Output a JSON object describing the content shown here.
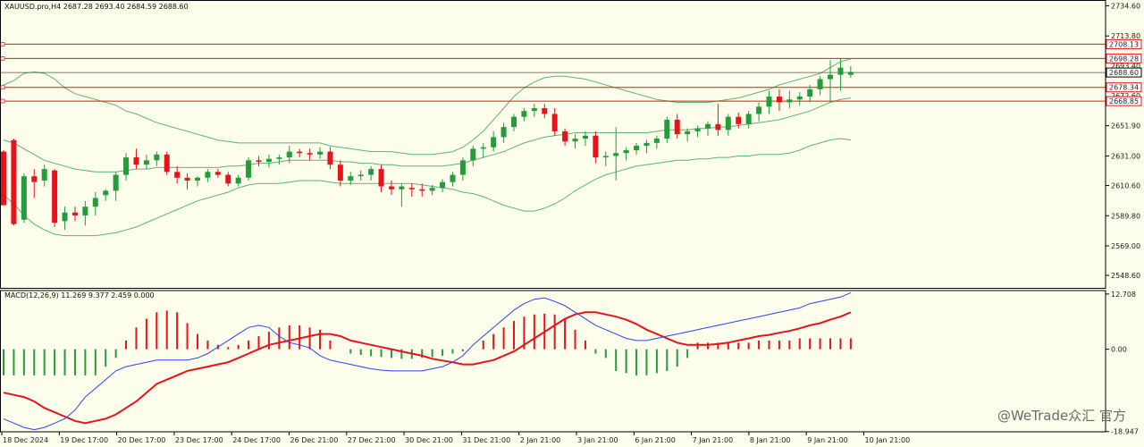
{
  "header": {
    "symbol_info": "XAUUSD.pro,H4  2687.28 2693.40 2684.59 2688.60",
    "macd_info": "MACD(12,26,9) 11.269 9.377 2.459 0.000"
  },
  "watermark": "@WeTrade众汇 官方",
  "colors": {
    "background": "#fcfdea",
    "bull": "#239c3c",
    "bear": "#e8131a",
    "bands": "#5cb572",
    "level_line": "#e8131a",
    "macd_signal": "#e8131a",
    "macd_main": "#2d44f0"
  },
  "price_axis": {
    "min": 2540,
    "max": 2738,
    "ticks": [
      "2734.60",
      "2713.80",
      "2651.90",
      "2631.00",
      "2610.60",
      "2589.80",
      "2569.00",
      "2548.60"
    ],
    "hidden_ticks": [
      "2693.40",
      "2672.60"
    ]
  },
  "level_labels": [
    {
      "value": 2708.13,
      "label": "2708.13"
    },
    {
      "value": 2698.28,
      "label": "2698.28"
    },
    {
      "value": 2678.34,
      "label": "2678.34"
    },
    {
      "value": 2668.85,
      "label": "2668.85"
    }
  ],
  "current_price": {
    "value": 2688.6,
    "label": "2688.60"
  },
  "macd_axis": {
    "min": -19,
    "max": 13.5,
    "ticks": [
      "12.708",
      "0.00",
      "-18.947"
    ]
  },
  "time_axis": [
    "18 Dec 2024",
    "19 Dec 17:00",
    "20 Dec 17:00",
    "23 Dec 17:00",
    "24 Dec 17:00",
    "26 Dec 21:00",
    "27 Dec 21:00",
    "30 Dec 21:00",
    "31 Dec 21:00",
    "2 Jan 21:00",
    "3 Jan 21:00",
    "6 Jan 21:00",
    "7 Jan 21:00",
    "8 Jan 21:00",
    "9 Jan 21:00",
    "10 Jan 21:00"
  ],
  "chart_data": {
    "type": "candlestick",
    "symbol": "XAUUSD.pro",
    "timeframe": "H4",
    "candles": [
      [
        2634,
        2635,
        2598,
        2597
      ],
      [
        2642,
        2643,
        2583,
        2584
      ],
      [
        2587,
        2619,
        2585,
        2617
      ],
      [
        2617,
        2622,
        2602,
        2613
      ],
      [
        2614,
        2625,
        2610,
        2622
      ],
      [
        2621,
        2622,
        2582,
        2585
      ],
      [
        2586,
        2596,
        2580,
        2592
      ],
      [
        2592,
        2596,
        2586,
        2590
      ],
      [
        2590,
        2600,
        2583,
        2596
      ],
      [
        2596,
        2606,
        2590,
        2602
      ],
      [
        2604,
        2608,
        2600,
        2607
      ],
      [
        2607,
        2620,
        2600,
        2618
      ],
      [
        2618,
        2633,
        2614,
        2630
      ],
      [
        2630,
        2636,
        2622,
        2625
      ],
      [
        2625,
        2632,
        2622,
        2628
      ],
      [
        2628,
        2634,
        2624,
        2632
      ],
      [
        2632,
        2634,
        2618,
        2620
      ],
      [
        2620,
        2624,
        2612,
        2616
      ],
      [
        2616,
        2619,
        2608,
        2614
      ],
      [
        2614,
        2617,
        2610,
        2616
      ],
      [
        2616,
        2622,
        2613,
        2620
      ],
      [
        2620,
        2622,
        2616,
        2618
      ],
      [
        2618,
        2620,
        2610,
        2612
      ],
      [
        2612,
        2618,
        2610,
        2616
      ],
      [
        2616,
        2630,
        2614,
        2628
      ],
      [
        2628,
        2631,
        2624,
        2627
      ],
      [
        2627,
        2632,
        2623,
        2629
      ],
      [
        2629,
        2632,
        2625,
        2630
      ],
      [
        2630,
        2638,
        2626,
        2634
      ],
      [
        2634,
        2636,
        2630,
        2633
      ],
      [
        2633,
        2636,
        2628,
        2632
      ],
      [
        2632,
        2637,
        2629,
        2634
      ],
      [
        2634,
        2637,
        2622,
        2625
      ],
      [
        2625,
        2628,
        2610,
        2614
      ],
      [
        2614,
        2620,
        2611,
        2617
      ],
      [
        2617,
        2621,
        2614,
        2618
      ],
      [
        2618,
        2624,
        2614,
        2622
      ],
      [
        2622,
        2625,
        2606,
        2610
      ],
      [
        2610,
        2614,
        2604,
        2608
      ],
      [
        2608,
        2612,
        2596,
        2610
      ],
      [
        2609,
        2612,
        2603,
        2608
      ],
      [
        2608,
        2612,
        2603,
        2607
      ],
      [
        2607,
        2611,
        2604,
        2609
      ],
      [
        2609,
        2615,
        2606,
        2613
      ],
      [
        2613,
        2620,
        2610,
        2618
      ],
      [
        2618,
        2630,
        2614,
        2628
      ],
      [
        2628,
        2638,
        2624,
        2636
      ],
      [
        2636,
        2640,
        2630,
        2637
      ],
      [
        2637,
        2648,
        2634,
        2644
      ],
      [
        2644,
        2654,
        2640,
        2651
      ],
      [
        2651,
        2660,
        2648,
        2658
      ],
      [
        2658,
        2664,
        2655,
        2662
      ],
      [
        2662,
        2667,
        2658,
        2664
      ],
      [
        2664,
        2667,
        2657,
        2660
      ],
      [
        2660,
        2664,
        2645,
        2648
      ],
      [
        2648,
        2650,
        2638,
        2641
      ],
      [
        2641,
        2646,
        2636,
        2643
      ],
      [
        2643,
        2648,
        2638,
        2645
      ],
      [
        2645,
        2648,
        2626,
        2630
      ],
      [
        2630,
        2634,
        2624,
        2631
      ],
      [
        2631,
        2651,
        2614,
        2633
      ],
      [
        2633,
        2637,
        2628,
        2635
      ],
      [
        2635,
        2640,
        2632,
        2638
      ],
      [
        2638,
        2642,
        2633,
        2640
      ],
      [
        2640,
        2645,
        2636,
        2643
      ],
      [
        2643,
        2658,
        2640,
        2656
      ],
      [
        2656,
        2660,
        2643,
        2646
      ],
      [
        2646,
        2650,
        2641,
        2648
      ],
      [
        2648,
        2652,
        2644,
        2650
      ],
      [
        2650,
        2655,
        2645,
        2653
      ],
      [
        2653,
        2667,
        2645,
        2649
      ],
      [
        2649,
        2660,
        2645,
        2658
      ],
      [
        2658,
        2661,
        2650,
        2653
      ],
      [
        2653,
        2662,
        2650,
        2660
      ],
      [
        2660,
        2668,
        2655,
        2665
      ],
      [
        2665,
        2676,
        2660,
        2672
      ],
      [
        2672,
        2677,
        2662,
        2668
      ],
      [
        2668,
        2676,
        2664,
        2670
      ],
      [
        2670,
        2675,
        2666,
        2672
      ],
      [
        2672,
        2680,
        2668,
        2677
      ],
      [
        2677,
        2686,
        2673,
        2684
      ],
      [
        2684,
        2697,
        2668,
        2687
      ],
      [
        2687,
        2698,
        2676,
        2692
      ],
      [
        2687,
        2693,
        2685,
        2689
      ]
    ],
    "bollinger": {
      "upper": [
        2680,
        2683,
        2688,
        2689,
        2688,
        2684,
        2678,
        2674,
        2672,
        2670,
        2668,
        2666,
        2662,
        2660,
        2657,
        2654,
        2652,
        2650,
        2648,
        2646,
        2644,
        2642,
        2641,
        2640,
        2640,
        2640,
        2640,
        2640,
        2640,
        2640,
        2640,
        2640,
        2638,
        2637,
        2636,
        2635,
        2634,
        2634,
        2634,
        2633,
        2632,
        2632,
        2632,
        2633,
        2634,
        2637,
        2642,
        2648,
        2656,
        2664,
        2672,
        2678,
        2682,
        2685,
        2686,
        2686,
        2685,
        2684,
        2682,
        2680,
        2678,
        2676,
        2674,
        2672,
        2670,
        2669,
        2668,
        2668,
        2668,
        2668,
        2669,
        2670,
        2671,
        2673,
        2675,
        2677,
        2680,
        2682,
        2684,
        2686,
        2688,
        2692,
        2696,
        2698
      ],
      "middle": [
        2642,
        2640,
        2636,
        2632,
        2628,
        2626,
        2624,
        2622,
        2621,
        2620,
        2620,
        2620,
        2621,
        2622,
        2622,
        2623,
        2623,
        2623,
        2623,
        2623,
        2623,
        2623,
        2624,
        2624,
        2625,
        2626,
        2626,
        2627,
        2628,
        2628,
        2628,
        2628,
        2628,
        2627,
        2627,
        2626,
        2626,
        2625,
        2625,
        2624,
        2624,
        2624,
        2624,
        2624,
        2625,
        2626,
        2628,
        2630,
        2632,
        2634,
        2637,
        2640,
        2642,
        2644,
        2645,
        2646,
        2647,
        2647,
        2647,
        2647,
        2647,
        2647,
        2647,
        2647,
        2648,
        2649,
        2649,
        2649,
        2650,
        2650,
        2651,
        2651,
        2652,
        2653,
        2654,
        2655,
        2656,
        2658,
        2660,
        2662,
        2665,
        2668,
        2670,
        2671
      ],
      "lower": [
        2604,
        2598,
        2590,
        2584,
        2580,
        2577,
        2576,
        2576,
        2576,
        2576,
        2577,
        2578,
        2580,
        2582,
        2585,
        2588,
        2591,
        2594,
        2597,
        2600,
        2602,
        2604,
        2606,
        2609,
        2611,
        2612,
        2612,
        2612,
        2613,
        2614,
        2614,
        2614,
        2613,
        2612,
        2612,
        2612,
        2612,
        2612,
        2612,
        2612,
        2612,
        2611,
        2610,
        2609,
        2608,
        2606,
        2605,
        2603,
        2600,
        2597,
        2595,
        2593,
        2593,
        2595,
        2598,
        2602,
        2607,
        2611,
        2615,
        2618,
        2620,
        2622,
        2624,
        2625,
        2626,
        2627,
        2628,
        2628,
        2629,
        2629,
        2630,
        2630,
        2631,
        2631,
        2632,
        2632,
        2632,
        2633,
        2635,
        2638,
        2640,
        2642,
        2643,
        2642
      ]
    },
    "levels": [
      2708.13,
      2698.28,
      2678.34,
      2668.85
    ],
    "macd": {
      "histogram": [
        -6,
        -6,
        -6,
        -6,
        -6,
        -6,
        -6,
        -6,
        -6,
        -6,
        -4,
        -2,
        2,
        5,
        7,
        8.5,
        8.9,
        8.5,
        6,
        3.5,
        2,
        1,
        0.5,
        1,
        2,
        3,
        4,
        5,
        5.5,
        5.5,
        5,
        4.5,
        2,
        0,
        -1,
        -1.3,
        -1.6,
        -1.8,
        -2,
        -2.2,
        -2.2,
        -2,
        -1.8,
        -1.5,
        -1,
        -0.5,
        0,
        2,
        3.5,
        5,
        6.5,
        7.5,
        8,
        8.2,
        8,
        7,
        4.5,
        2,
        -1,
        -2,
        -5,
        -5.5,
        -6,
        -6,
        -5.5,
        -5,
        -4,
        -2,
        1.5,
        1.5,
        1.5,
        1.5,
        1.5,
        1.5,
        2,
        2,
        2,
        2,
        2.5,
        2.5,
        2.5,
        2.5,
        2.5,
        2.5
      ],
      "signal": [
        -10,
        -10.5,
        -11,
        -12,
        -13.5,
        -14.5,
        -15.5,
        -16.5,
        -17,
        -16.5,
        -16,
        -15,
        -13.5,
        -12,
        -10,
        -8,
        -7,
        -6,
        -5,
        -4.5,
        -4,
        -3.5,
        -3,
        -2,
        -1,
        0,
        1,
        1.5,
        2,
        2.5,
        3,
        3.5,
        3.5,
        3,
        2,
        1.5,
        1,
        0.5,
        0,
        -0.5,
        -1,
        -1.5,
        -2.2,
        -2.6,
        -3,
        -3.5,
        -3.5,
        -3,
        -2.5,
        -1.5,
        -0.5,
        1,
        2.5,
        4,
        5.5,
        7,
        8,
        8.5,
        8.5,
        8,
        7.5,
        6.8,
        5.8,
        4.5,
        3.5,
        2.5,
        1.5,
        1,
        1,
        1,
        1.2,
        1.5,
        2,
        2.5,
        3,
        3.3,
        3.8,
        4.2,
        4.8,
        5.5,
        6,
        6.8,
        7.5,
        8.5
      ],
      "main": [
        -16,
        -17,
        -18,
        -18.5,
        -18,
        -17,
        -16,
        -14,
        -11,
        -9,
        -7,
        -5,
        -4,
        -3.5,
        -3,
        -2.5,
        -2.5,
        -2.5,
        -2.5,
        -2,
        -1,
        0.5,
        2,
        3.5,
        5,
        5.5,
        5,
        3,
        1.5,
        1,
        0.3,
        -1.5,
        -2.5,
        -3,
        -3.5,
        -4,
        -4.5,
        -4.8,
        -5,
        -5,
        -5,
        -5,
        -4.5,
        -4,
        -3,
        -1.5,
        1,
        3,
        5,
        7,
        9,
        10.5,
        11.5,
        11.8,
        11,
        10,
        8.5,
        7,
        5.5,
        4.5,
        3.5,
        2.5,
        2,
        2,
        2.5,
        3,
        3.5,
        4,
        4.5,
        5,
        5.5,
        6,
        6.5,
        7,
        7.5,
        8,
        8.5,
        9,
        9.5,
        10.5,
        11,
        11.5,
        12,
        13
      ]
    }
  }
}
